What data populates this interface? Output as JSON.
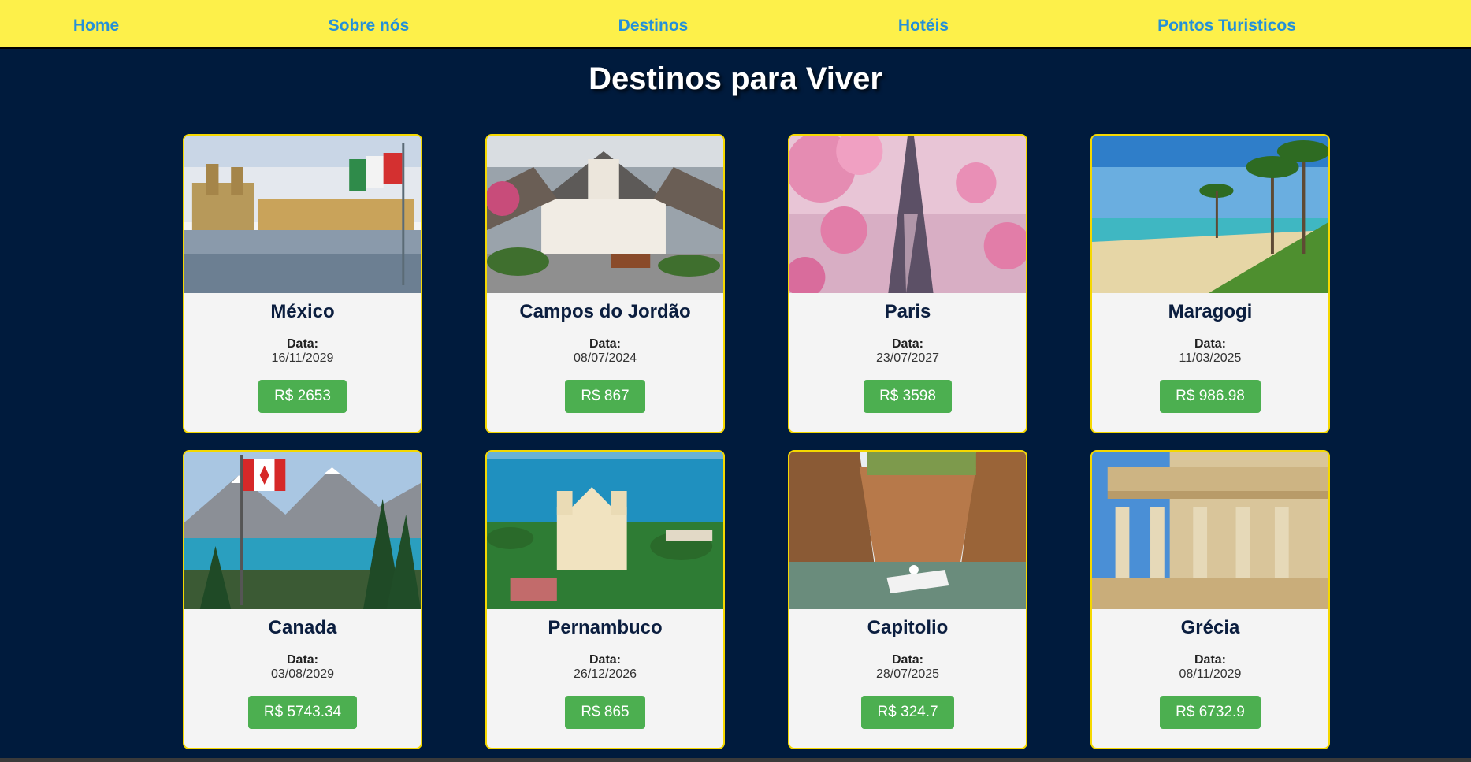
{
  "nav": {
    "items": [
      {
        "label": "Home"
      },
      {
        "label": "Sobre nós"
      },
      {
        "label": "Destinos"
      },
      {
        "label": "Hotéis"
      },
      {
        "label": "Pontos Turisticos"
      }
    ]
  },
  "page": {
    "title": "Destinos para Viver"
  },
  "cards": [
    {
      "name": "México",
      "date_label": "Data:",
      "date": "16/11/2029",
      "price": "R$ 2653",
      "image": "mexico-city-zocalo-photo"
    },
    {
      "name": "Campos do Jordão",
      "date_label": "Data:",
      "date": "08/07/2024",
      "price": "R$ 867",
      "image": "campos-do-jordao-village-photo"
    },
    {
      "name": "Paris",
      "date_label": "Data:",
      "date": "23/07/2027",
      "price": "R$ 3598",
      "image": "paris-eiffel-tower-blossom-photo"
    },
    {
      "name": "Maragogi",
      "date_label": "Data:",
      "date": "11/03/2025",
      "price": "R$ 986.98",
      "image": "maragogi-beach-palms-photo"
    },
    {
      "name": "Canada",
      "date_label": "Data:",
      "date": "03/08/2029",
      "price": "R$ 5743.34",
      "image": "canada-lake-flag-photo"
    },
    {
      "name": "Pernambuco",
      "date_label": "Data:",
      "date": "26/12/2026",
      "price": "R$ 865",
      "image": "pernambuco-olinda-church-photo"
    },
    {
      "name": "Capitolio",
      "date_label": "Data:",
      "date": "28/07/2025",
      "price": "R$ 324.7",
      "image": "capitolio-canyon-boat-photo"
    },
    {
      "name": "Grécia",
      "date_label": "Data:",
      "date": "08/11/2029",
      "price": "R$ 6732.9",
      "image": "greece-caryatids-photo"
    }
  ],
  "colors": {
    "background": "#001b3d",
    "nav_bar": "#fdf04a",
    "nav_link": "#2590d8",
    "card_border": "#f5d800",
    "price_button": "#4caf50"
  }
}
